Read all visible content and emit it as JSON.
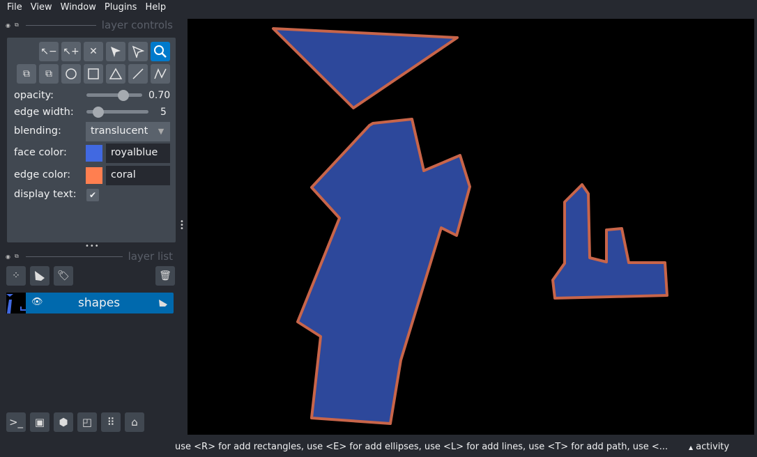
{
  "menu": [
    "File",
    "View",
    "Window",
    "Plugins",
    "Help"
  ],
  "layer_controls": {
    "title": "layer controls",
    "tools_row1": [
      {
        "icon": "remove-vertex-icon",
        "glyph": "⇱−"
      },
      {
        "icon": "add-vertex-icon",
        "glyph": "⇱+"
      },
      {
        "icon": "delete-shape-icon",
        "glyph": "✕"
      },
      {
        "icon": "select-icon",
        "glyph": "➤"
      },
      {
        "icon": "direct-select-icon",
        "glyph": "➢"
      },
      {
        "icon": "zoom-pan-icon",
        "glyph": "🔍"
      }
    ],
    "tools_row2": [
      {
        "icon": "move-back-icon",
        "glyph": "⧉"
      },
      {
        "icon": "move-front-icon",
        "glyph": "⧉"
      },
      {
        "icon": "ellipse-icon",
        "glyph": "◯"
      },
      {
        "icon": "rectangle-icon",
        "glyph": "▢"
      },
      {
        "icon": "polygon-icon",
        "glyph": "△"
      },
      {
        "icon": "line-icon",
        "glyph": "⟋"
      },
      {
        "icon": "path-icon",
        "glyph": "⋀"
      }
    ],
    "opacity_label": "opacity:",
    "opacity": "0.70",
    "edge_width_label": "edge width:",
    "edge_width": "5",
    "blending_label": "blending:",
    "blending": "translucent",
    "face_color_label": "face color:",
    "face_color": "royalblue",
    "face_hex": "#4169e1",
    "edge_color_label": "edge color:",
    "edge_color": "coral",
    "edge_hex": "#ff7f50",
    "display_text_label": "display text:",
    "display_text": true
  },
  "layer_list": {
    "title": "layer list",
    "layers": [
      {
        "name": "shapes",
        "visible": true
      }
    ]
  },
  "status": "use <R> for add rectangles, use <E> for add ellipses, use <L> for add lines, use <T> for add path, use <...",
  "activity": "activity"
}
